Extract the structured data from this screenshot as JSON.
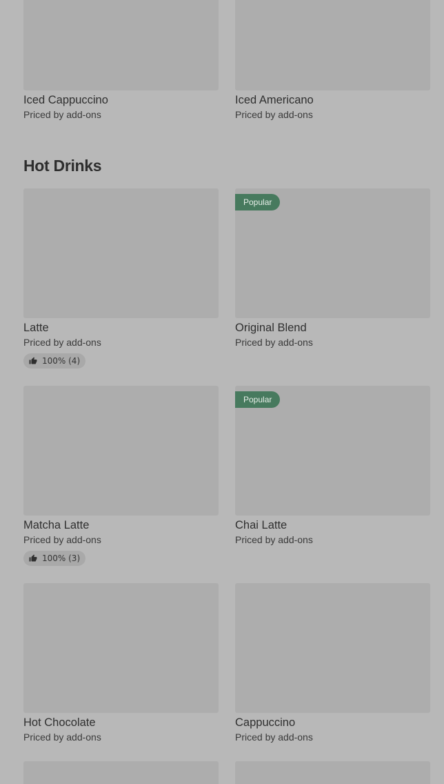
{
  "top_row": [
    {
      "name": "Iced Cappuccino",
      "price": "Priced by add-ons"
    },
    {
      "name": "Iced Americano",
      "price": "Priced by add-ons"
    }
  ],
  "section": {
    "title": "Hot Drinks"
  },
  "items": [
    {
      "name": "Latte",
      "price": "Priced by add-ons",
      "rating": "100% (4)"
    },
    {
      "name": "Original Blend",
      "price": "Priced by add-ons",
      "badge": "Popular"
    },
    {
      "name": "Matcha Latte",
      "price": "Priced by add-ons",
      "rating": "100% (3)"
    },
    {
      "name": "Chai Latte",
      "price": "Priced by add-ons",
      "badge": "Popular"
    },
    {
      "name": "Hot Chocolate",
      "price": "Priced by add-ons"
    },
    {
      "name": "Cappuccino",
      "price": "Priced by add-ons"
    }
  ],
  "icons": {
    "rating": "thumbs-up-icon"
  },
  "colors": {
    "background": "#b8b8b8",
    "placeholder": "#adadad",
    "badge": "#477a5e",
    "text": "#333333"
  }
}
